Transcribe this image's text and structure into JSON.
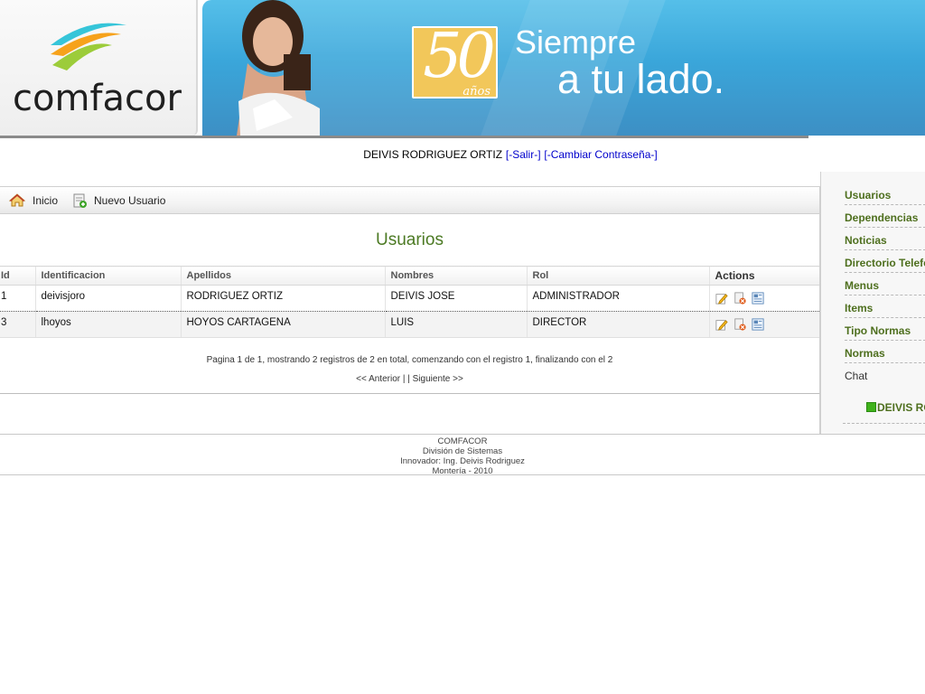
{
  "header": {
    "logo_text": "comfacor",
    "badge_number": "50",
    "badge_subtext": "años",
    "slogan_line1": "Siempre",
    "slogan_line2": "a tu lado."
  },
  "userbar": {
    "user_name": "DEIVIS RODRIGUEZ ORTIZ",
    "logout_label": "[-Salir-]",
    "change_password_label": "[-Cambiar Contraseña-]"
  },
  "toolbar": {
    "home_label": "Inicio",
    "new_user_label": "Nuevo Usuario",
    "home_icon": "home-icon",
    "new_user_icon": "new-document-icon"
  },
  "main": {
    "title": "Usuarios",
    "columns": [
      "Id",
      "Identificacion",
      "Apellidos",
      "Nombres",
      "Rol",
      "Actions"
    ],
    "rows": [
      {
        "id": "1",
        "identificacion": "deivisjoro",
        "apellidos": "RODRIGUEZ ORTIZ",
        "nombres": "DEIVIS JOSE",
        "rol": "ADMINISTRADOR"
      },
      {
        "id": "3",
        "identificacion": "lhoyos",
        "apellidos": "HOYOS CARTAGENA",
        "nombres": "LUIS",
        "rol": "DIRECTOR"
      }
    ],
    "row_actions": [
      "edit-icon",
      "delete-icon",
      "view-icon"
    ],
    "paging_info": "Pagina 1 de 1, mostrando 2 registros de 2 en total, comenzando con el registro 1, finalizando con el 2",
    "prev_label": "<< Anterior",
    "separator": "|  |",
    "next_label": "Siguiente >>"
  },
  "sidebar": {
    "items": [
      {
        "label": "Usuarios"
      },
      {
        "label": "Dependencias"
      },
      {
        "label": "Noticias"
      },
      {
        "label": "Directorio Telefonico"
      },
      {
        "label": "Menus"
      },
      {
        "label": "Items"
      },
      {
        "label": "Tipo Normas"
      },
      {
        "label": "Normas"
      }
    ],
    "chat_label": "Chat",
    "chat_user": "DEIVIS RODRIGUEZ",
    "chat_status_color": "#3fb21b"
  },
  "footer": {
    "line1": "COMFACOR",
    "line2": "División de Sistemas",
    "line3": "Innovador: Ing. Deivis Rodriguez",
    "line4": "Montería - 2010"
  },
  "colors": {
    "accent_green": "#4c7a24",
    "link_blue": "#0000cc",
    "banner_blue": "#3aa6da"
  }
}
